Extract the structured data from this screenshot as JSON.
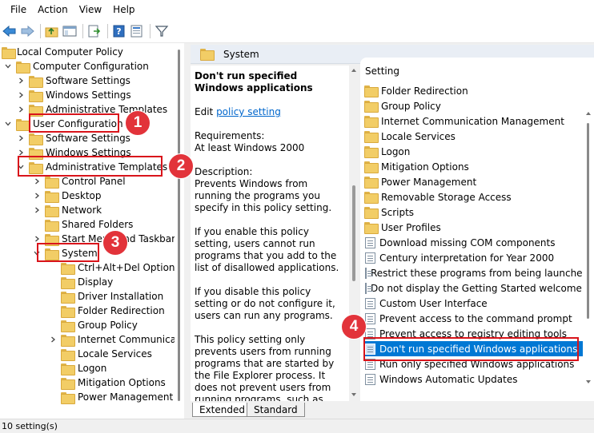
{
  "menu": [
    "File",
    "Action",
    "View",
    "Help"
  ],
  "toolbar": {
    "buttons": [
      "back-icon",
      "forward-icon",
      "up-folder-icon",
      "show-hide-tree-icon",
      "export-list-icon",
      "help-icon",
      "properties-icon",
      "filter-icon"
    ]
  },
  "tree": {
    "root": "Local Computer Policy",
    "computer_config": "Computer Configuration",
    "cc_software": "Software Settings",
    "cc_windows": "Windows Settings",
    "cc_admin": "Administrative Templates",
    "user_config": "User Configuration",
    "uc_software": "Software Settings",
    "uc_windows": "Windows Settings",
    "uc_admin": "Administrative Templates",
    "control_panel": "Control Panel",
    "desktop": "Desktop",
    "network": "Network",
    "shared_folders": "Shared Folders",
    "start_menu": "Start Menu and Taskbar",
    "system": "System",
    "system_children": [
      "Ctrl+Alt+Del Options",
      "Display",
      "Driver Installation",
      "Folder Redirection",
      "Group Policy",
      "Internet Communication Management",
      "Locale Services",
      "Logon",
      "Mitigation Options",
      "Power Management"
    ]
  },
  "right_header": {
    "title": "System"
  },
  "description": {
    "title": "Don't run specified Windows applications",
    "edit_prefix": "Edit ",
    "edit_link": "policy setting ",
    "requirements_label": "Requirements:",
    "requirements_value": "At least Windows 2000",
    "description_label": "Description:",
    "description_text": "Prevents Windows from running the programs you specify in this policy setting.",
    "enabled_text": "If you enable this policy setting, users cannot run programs that you add to the list of disallowed applications.",
    "disabled_text": "If you disable this policy setting or do not configure it, users can run any programs.",
    "prevents_text": "This policy setting only prevents users from running programs that are started by the File Explorer process. It does not prevent users from running programs, such as Task Manager, which are started"
  },
  "list": {
    "column_header": "Setting",
    "items": [
      "Folder Redirection",
      "Group Policy",
      "Internet Communication Management",
      "Locale Services",
      "Logon",
      "Mitigation Options",
      "Power Management",
      "Removable Storage Access",
      "Scripts",
      "User Profiles",
      "Download missing COM components",
      "Century interpretation for Year 2000",
      "Restrict these programs from being launched from Help",
      "Do not display the Getting Started welcome screen at logon",
      "Custom User Interface",
      "Prevent access to the command prompt",
      "Prevent access to registry editing tools",
      "Don't run specified Windows applications",
      "Run only specified Windows applications",
      "Windows Automatic Updates"
    ]
  },
  "tabs": [
    "Extended",
    "Standard"
  ],
  "status": "10 setting(s)",
  "callouts": [
    "1",
    "2",
    "3",
    "4"
  ],
  "colors": {
    "accent": "#0078d4",
    "callout": "#e2333a",
    "folder": "#f2cd66"
  }
}
